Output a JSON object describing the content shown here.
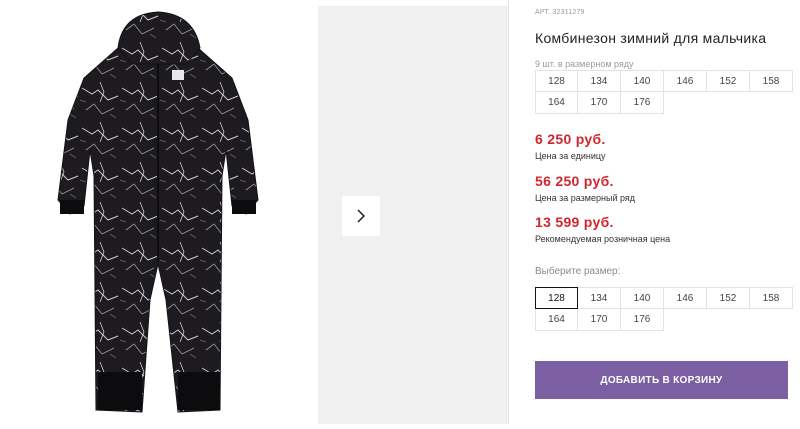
{
  "product": {
    "sku": "АРТ. 32311279",
    "title": "Комбинезон зимний для мальчика",
    "row_note": "9 шт. в размерном ряду",
    "row_sizes": [
      "128",
      "134",
      "140",
      "146",
      "152",
      "158",
      "164",
      "170",
      "176"
    ]
  },
  "prices": [
    {
      "value": "6 250 руб.",
      "label": "Цена за единицу"
    },
    {
      "value": "56 250 руб.",
      "label": "Цена за размерный ряд"
    },
    {
      "value": "13 599 руб.",
      "label": "Рекомендуемая розничная цена"
    }
  ],
  "size_picker": {
    "label": "Выберите размер:",
    "selected": "128",
    "options": [
      "128",
      "134",
      "140",
      "146",
      "152",
      "158",
      "164",
      "170",
      "176"
    ]
  },
  "cart": {
    "button_label": "ДОБАВИТЬ В КОРЗИНУ"
  },
  "gallery": {
    "next_icon": "chevron-right-icon"
  },
  "colors": {
    "price": "#d1262e",
    "cart_button": "#7b5fa2",
    "thumb_bg": "#f0f0f0"
  }
}
